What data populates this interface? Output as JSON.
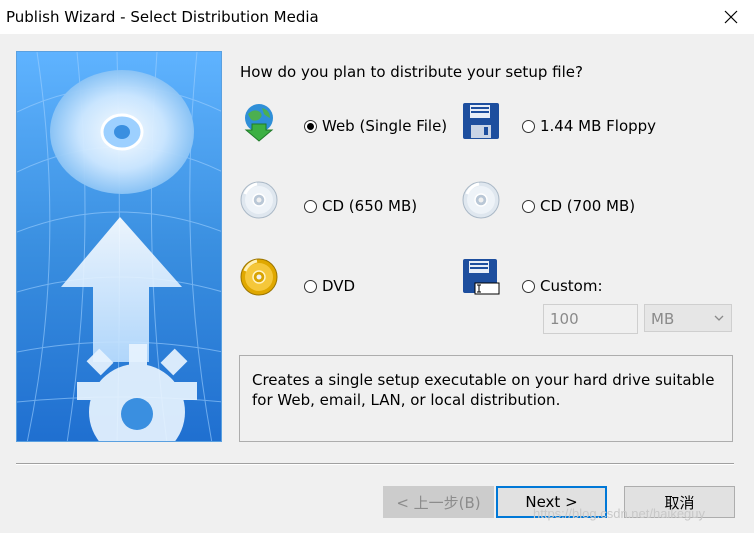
{
  "window": {
    "title": "Publish Wizard - Select Distribution Media"
  },
  "main": {
    "question": "How do you plan to distribute your setup file?",
    "options": [
      {
        "label": "Web (Single File)",
        "checked": true,
        "icon": "globe-download-icon"
      },
      {
        "label": "1.44 MB Floppy",
        "checked": false,
        "icon": "floppy-disk-icon"
      },
      {
        "label": "CD (650 MB)",
        "checked": false,
        "icon": "cd-disc-icon"
      },
      {
        "label": "CD (700 MB)",
        "checked": false,
        "icon": "cd-disc-icon"
      },
      {
        "label": "DVD",
        "checked": false,
        "icon": "dvd-disc-icon"
      },
      {
        "label": "Custom:",
        "checked": false,
        "icon": "custom-floppy-icon"
      }
    ],
    "custom_size": {
      "value": "100",
      "unit": "MB"
    },
    "description": "Creates a single setup executable on your hard drive suitable for Web, email, LAN, or local distribution."
  },
  "footer": {
    "back_label": "< 上一步(B)",
    "next_label": "Next >",
    "cancel_label": "取消"
  },
  "watermark": "https://blog.csdn.net/haikeguy",
  "colors": {
    "accent": "#0078d7",
    "banner_blue": "#3a8fe0"
  }
}
